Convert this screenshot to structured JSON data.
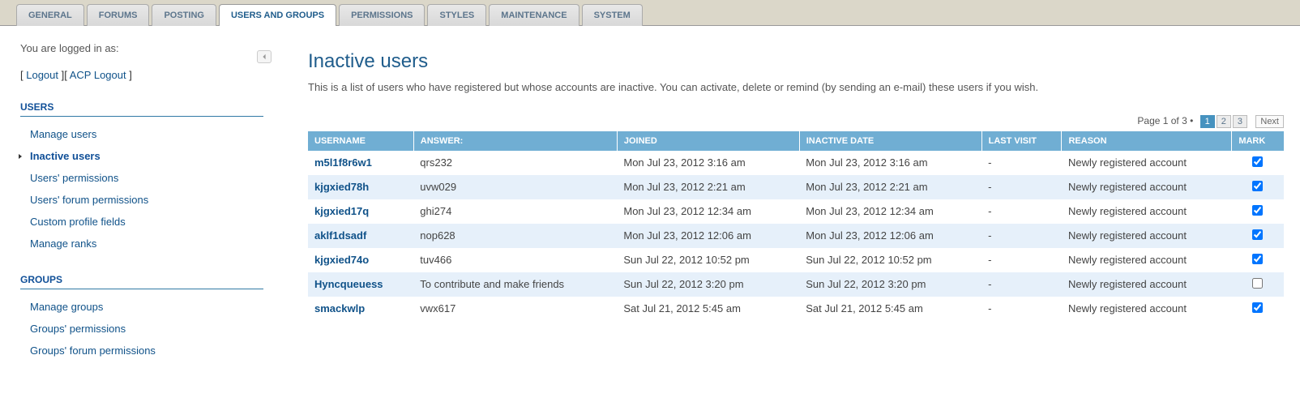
{
  "tabs": [
    {
      "label": "GENERAL"
    },
    {
      "label": "FORUMS"
    },
    {
      "label": "POSTING"
    },
    {
      "label": "USERS AND GROUPS"
    },
    {
      "label": "PERMISSIONS"
    },
    {
      "label": "STYLES"
    },
    {
      "label": "MAINTENANCE"
    },
    {
      "label": "SYSTEM"
    }
  ],
  "activeTab": 3,
  "sidebar": {
    "loginInfo": "You are logged in as:",
    "logout1": "Logout",
    "logout2": "ACP Logout",
    "sections": [
      {
        "title": "USERS",
        "items": [
          {
            "label": "Manage users"
          },
          {
            "label": "Inactive users",
            "active": true
          },
          {
            "label": "Users' permissions"
          },
          {
            "label": "Users' forum permissions"
          },
          {
            "label": "Custom profile fields"
          },
          {
            "label": "Manage ranks"
          }
        ]
      },
      {
        "title": "GROUPS",
        "items": [
          {
            "label": "Manage groups"
          },
          {
            "label": "Groups' permissions"
          },
          {
            "label": "Groups' forum permissions"
          }
        ]
      }
    ]
  },
  "page": {
    "title": "Inactive users",
    "description": "This is a list of users who have registered but whose accounts are inactive. You can activate, delete or remind (by sending an e-mail) these users if you wish."
  },
  "pagination": {
    "pageOf": "Page 1 of 3 •",
    "pages": [
      "1",
      "2",
      "3"
    ],
    "current": 0,
    "next": "Next"
  },
  "table": {
    "headers": [
      "USERNAME",
      "ANSWER:",
      "JOINED",
      "INACTIVE DATE",
      "LAST VISIT",
      "REASON",
      "MARK"
    ],
    "rows": [
      {
        "username": "m5l1f8r6w1",
        "answer": "qrs232",
        "joined": "Mon Jul 23, 2012 3:16 am",
        "inactive": "Mon Jul 23, 2012 3:16 am",
        "lastvisit": "-",
        "reason": "Newly registered account",
        "checked": true
      },
      {
        "username": "kjgxied78h",
        "answer": "uvw029",
        "joined": "Mon Jul 23, 2012 2:21 am",
        "inactive": "Mon Jul 23, 2012 2:21 am",
        "lastvisit": "-",
        "reason": "Newly registered account",
        "checked": true
      },
      {
        "username": "kjgxied17q",
        "answer": "ghi274",
        "joined": "Mon Jul 23, 2012 12:34 am",
        "inactive": "Mon Jul 23, 2012 12:34 am",
        "lastvisit": "-",
        "reason": "Newly registered account",
        "checked": true
      },
      {
        "username": "aklf1dsadf",
        "answer": "nop628",
        "joined": "Mon Jul 23, 2012 12:06 am",
        "inactive": "Mon Jul 23, 2012 12:06 am",
        "lastvisit": "-",
        "reason": "Newly registered account",
        "checked": true
      },
      {
        "username": "kjgxied74o",
        "answer": "tuv466",
        "joined": "Sun Jul 22, 2012 10:52 pm",
        "inactive": "Sun Jul 22, 2012 10:52 pm",
        "lastvisit": "-",
        "reason": "Newly registered account",
        "checked": true
      },
      {
        "username": "Hyncqueuess",
        "answer": "To contribute and make friends",
        "joined": "Sun Jul 22, 2012 3:20 pm",
        "inactive": "Sun Jul 22, 2012 3:20 pm",
        "lastvisit": "-",
        "reason": "Newly registered account",
        "checked": false
      },
      {
        "username": "smackwlp",
        "answer": "vwx617",
        "joined": "Sat Jul 21, 2012 5:45 am",
        "inactive": "Sat Jul 21, 2012 5:45 am",
        "lastvisit": "-",
        "reason": "Newly registered account",
        "checked": true
      }
    ]
  }
}
